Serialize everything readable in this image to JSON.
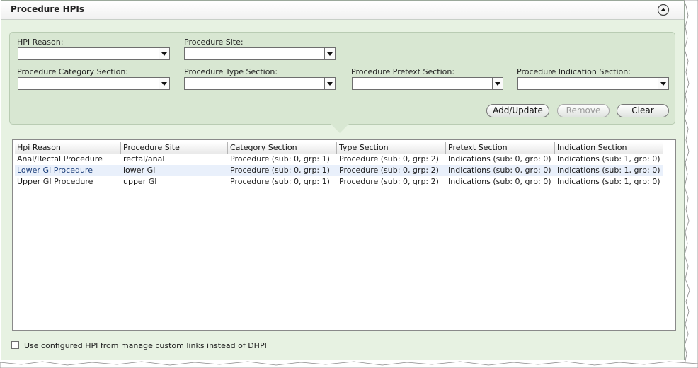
{
  "panel": {
    "title": "Procedure HPIs",
    "collapse_icon": "chevron-up-circle-icon"
  },
  "filters": {
    "hpi_reason": {
      "label": "HPI Reason:",
      "value": ""
    },
    "procedure_site": {
      "label": "Procedure Site:",
      "value": ""
    },
    "category_section": {
      "label": "Procedure Category Section:",
      "value": ""
    },
    "type_section": {
      "label": "Procedure Type Section:",
      "value": ""
    },
    "pretext_section": {
      "label": "Procedure Pretext Section:",
      "value": ""
    },
    "indication_section": {
      "label": "Procedure Indication Section:",
      "value": ""
    }
  },
  "buttons": {
    "add_update": "Add/Update",
    "remove": "Remove",
    "clear": "Clear"
  },
  "table": {
    "columns": [
      "Hpi Reason",
      "Procedure Site",
      "Category Section",
      "Type Section",
      "Pretext Section",
      "Indication Section"
    ],
    "rows": [
      [
        "Anal/Rectal Procedure",
        "rectal/anal",
        "Procedure (sub: 0, grp: 1)",
        "Procedure (sub: 0, grp: 2)",
        "Indications (sub: 0, grp: 0)",
        "Indications (sub: 1, grp: 0)"
      ],
      [
        "Lower GI Procedure",
        "lower GI",
        "Procedure (sub: 0, grp: 1)",
        "Procedure (sub: 0, grp: 2)",
        "Indications (sub: 0, grp: 0)",
        "Indications (sub: 1, grp: 0)"
      ],
      [
        "Upper GI Procedure",
        "upper GI",
        "Procedure (sub: 0, grp: 1)",
        "Procedure (sub: 0, grp: 2)",
        "Indications (sub: 0, grp: 0)",
        "Indications (sub: 1, grp: 0)"
      ]
    ]
  },
  "options": {
    "use_configured_hpi_label": "Use configured HPI from manage custom links instead of DHPI",
    "use_configured_hpi_checked": false
  },
  "colors": {
    "panel_bg": "#e7f2e2",
    "filter_bg": "#d8e7d2",
    "row_alt": "#e9f0fb"
  }
}
